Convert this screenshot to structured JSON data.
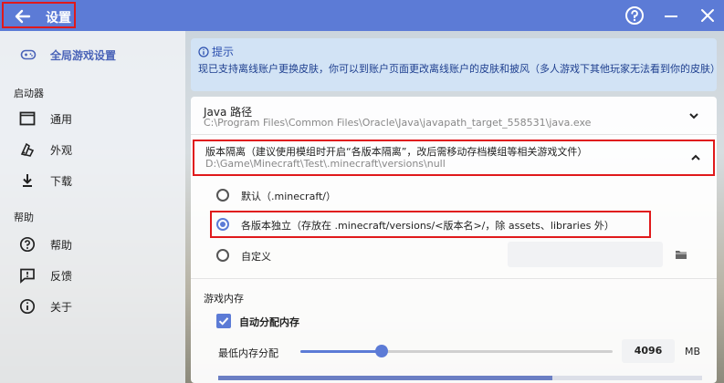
{
  "titlebar": {
    "title": "设置",
    "help_icon": "help-circle-icon",
    "minimize_icon": "minimize-icon",
    "close_icon": "close-icon"
  },
  "sidebar": {
    "global_label": "全局游戏设置",
    "launcher_heading": "启动器",
    "launcher_items": [
      {
        "label": "通用",
        "icon": "window-icon"
      },
      {
        "label": "外观",
        "icon": "palette-icon"
      },
      {
        "label": "下载",
        "icon": "download-icon"
      }
    ],
    "help_heading": "帮助",
    "help_items": [
      {
        "label": "帮助",
        "icon": "help-circle-icon"
      },
      {
        "label": "反馈",
        "icon": "feedback-icon"
      },
      {
        "label": "关于",
        "icon": "info-icon"
      }
    ]
  },
  "tip": {
    "title": "提示",
    "text": "现已支持离线账户更换皮肤，你可以到账户页面更改离线账户的皮肤和披风（多人游戏下其他玩家无法看到你的皮肤）"
  },
  "java": {
    "label": "Java 路径",
    "value": "C:\\Program Files\\Common Files\\Oracle\\Java\\javapath_target_558531\\java.exe"
  },
  "isolation": {
    "label": "版本隔离（建议使用模组时开启“各版本隔离”，改后需移动存档模组等相关游戏文件）",
    "value": "D:\\Game\\Minecraft\\Test\\.minecraft\\versions\\null",
    "options": [
      {
        "label": "默认（.minecraft/）",
        "selected": false
      },
      {
        "label": "各版本独立（存放在 .minecraft/versions/<版本名>/，除 assets、libraries 外）",
        "selected": true
      },
      {
        "label": "自定义",
        "selected": false
      }
    ]
  },
  "memory": {
    "title": "游戏内存",
    "auto_label": "自动分配内存",
    "auto_checked": true,
    "min_label": "最低内存分配",
    "min_value": "4096",
    "unit": "MB",
    "slider_fraction": 0.26,
    "usage_fraction": 0.69
  },
  "colors": {
    "accent": "#5c7bd6",
    "highlight": "#e0191b",
    "tip_bg": "#d2e3f5"
  }
}
